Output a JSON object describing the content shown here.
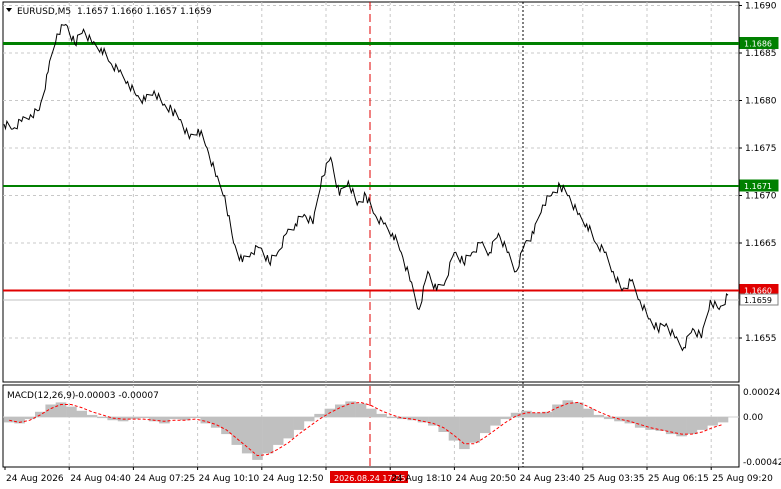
{
  "header": {
    "symbol": "EURUSD,M5",
    "ohlc": "1.1657 1.1660 1.1657 1.1659"
  },
  "macd_label": {
    "name": "MACD(12,26,9)",
    "values": "-0.00003 -0.00007"
  },
  "chart_data": [
    {
      "type": "line",
      "panel": "price",
      "ylim": [
        1.165,
        1.169
      ],
      "yticks": [
        "1.1690",
        "1.1685",
        "1.1680",
        "1.1675",
        "1.1670",
        "1.1665",
        "1.1660",
        "1.1655"
      ],
      "grid": true,
      "colors": {
        "line": "#000000",
        "grid": "#c8c8c8",
        "support_high": "#008000",
        "support_mid": "#008000",
        "resistance": "#e00000",
        "current": "#c0c0c0"
      },
      "series": [
        {
          "values": [
            1.16775,
            1.1677,
            1.16778,
            1.16785,
            1.1679,
            1.1683,
            1.1687,
            1.1688,
            1.1686,
            1.16875,
            1.1686,
            1.16855,
            1.1684,
            1.1683,
            1.1682,
            1.16805,
            1.168,
            1.1681,
            1.16795,
            1.1679,
            1.1678,
            1.1676,
            1.1677,
            1.1675,
            1.1672,
            1.167,
            1.1665,
            1.1663,
            1.1664,
            1.16645,
            1.1663,
            1.1664,
            1.1666,
            1.1667,
            1.1668,
            1.1667,
            1.1672,
            1.1674,
            1.167,
            1.16715,
            1.1669,
            1.167,
            1.1668,
            1.1667,
            1.1666,
            1.1664,
            1.1661,
            1.1658,
            1.1662,
            1.166,
            1.1661,
            1.1664,
            1.1663,
            1.1664,
            1.1665,
            1.1664,
            1.1666,
            1.1664,
            1.1662,
            1.1665,
            1.1666,
            1.1669,
            1.167,
            1.1671,
            1.167,
            1.1668,
            1.1667,
            1.1665,
            1.1664,
            1.1662,
            1.166,
            1.1661,
            1.1659,
            1.1657,
            1.1656,
            1.16565,
            1.1655,
            1.1654,
            1.1656,
            1.1655,
            1.1659,
            1.1658,
            1.16595
          ]
        }
      ],
      "lines": [
        {
          "label": "1.1686",
          "value": 1.1686,
          "color": "#008000"
        },
        {
          "label": "1.1671",
          "value": 1.1671,
          "color": "#008000"
        },
        {
          "label": "1.1660",
          "value": 1.166,
          "color": "#e00000"
        },
        {
          "label": "1.1659",
          "value": 1.1659,
          "color": "#c0c0c0"
        }
      ],
      "xticks": [
        "24 Aug 2026",
        "24 Aug 04:40",
        "24 Aug 07:25",
        "24 Aug 10:10",
        "24 Aug 12:50",
        "2026.08.24 17:25",
        "24 Aug 18:10",
        "24 Aug 20:50",
        "24 Aug 23:40",
        "25 Aug 03:35",
        "25 Aug 06:15",
        "25 Aug 09:20"
      ],
      "marked_time": "2026.08.24 17:25"
    },
    {
      "type": "bar",
      "panel": "macd",
      "title": "MACD(12,26,9) -0.00003 -0.00007",
      "ylim": [
        -0.00042,
        0.00024
      ],
      "yticks": [
        "0.00024",
        "0.00",
        "-0.00042"
      ],
      "colors": {
        "histogram": "#c0c0c0",
        "signal": "#ff0000"
      },
      "histogram": [
        -5e-05,
        -6e-05,
        -2e-05,
        5e-05,
        0.00012,
        0.00014,
        0.0001,
        6e-05,
        2e-05,
        -1e-05,
        -3e-05,
        -4e-05,
        -2e-05,
        -1e-05,
        -4e-05,
        -6e-05,
        -2e-05,
        -3e-05,
        -1e-05,
        -6e-05,
        -0.0001,
        -0.00016,
        -0.00026,
        -0.00034,
        -0.0004,
        -0.00034,
        -0.00026,
        -0.0002,
        -0.00012,
        -4e-05,
        3e-05,
        8e-05,
        0.00012,
        0.00015,
        0.00013,
        8e-05,
        3e-05,
        -1e-05,
        -2e-05,
        -3e-05,
        -5e-05,
        -8e-05,
        -0.00014,
        -0.00022,
        -0.0003,
        -0.00024,
        -0.00015,
        -8e-05,
        -2e-05,
        4e-05,
        6e-05,
        4e-05,
        5e-05,
        0.00012,
        0.00016,
        0.00014,
        8e-05,
        2e-05,
        -2e-05,
        -4e-05,
        -6e-05,
        -0.0001,
        -0.00012,
        -0.00013,
        -0.00016,
        -0.00018,
        -0.00016,
        -0.00012,
        -8e-05,
        -5e-05
      ],
      "signal": [
        -3e-05,
        -5e-05,
        -3e-05,
        2e-05,
        8e-05,
        0.00012,
        0.00012,
        9e-05,
        5e-05,
        2e-05,
        -1e-05,
        -2e-05,
        -2e-05,
        -2e-05,
        -3e-05,
        -4e-05,
        -3e-05,
        -3e-05,
        -2e-05,
        -4e-05,
        -7e-05,
        -0.00012,
        -0.0002,
        -0.00028,
        -0.00036,
        -0.00035,
        -0.0003,
        -0.00024,
        -0.00016,
        -9e-05,
        -2e-05,
        4e-05,
        9e-05,
        0.00013,
        0.00014,
        0.00011,
        6e-05,
        2e-05,
        -1e-05,
        -2e-05,
        -4e-05,
        -6e-05,
        -0.0001,
        -0.00017,
        -0.00025,
        -0.00025,
        -0.00019,
        -0.00012,
        -5e-05,
        1e-05,
        4e-05,
        4e-05,
        4e-05,
        9e-05,
        0.00013,
        0.00014,
        0.0001,
        5e-05,
        1e-05,
        -2e-05,
        -4e-05,
        -7e-05,
        -0.0001,
        -0.00012,
        -0.00014,
        -0.00016,
        -0.00016,
        -0.00014,
        -0.0001,
        -7e-05
      ]
    }
  ]
}
